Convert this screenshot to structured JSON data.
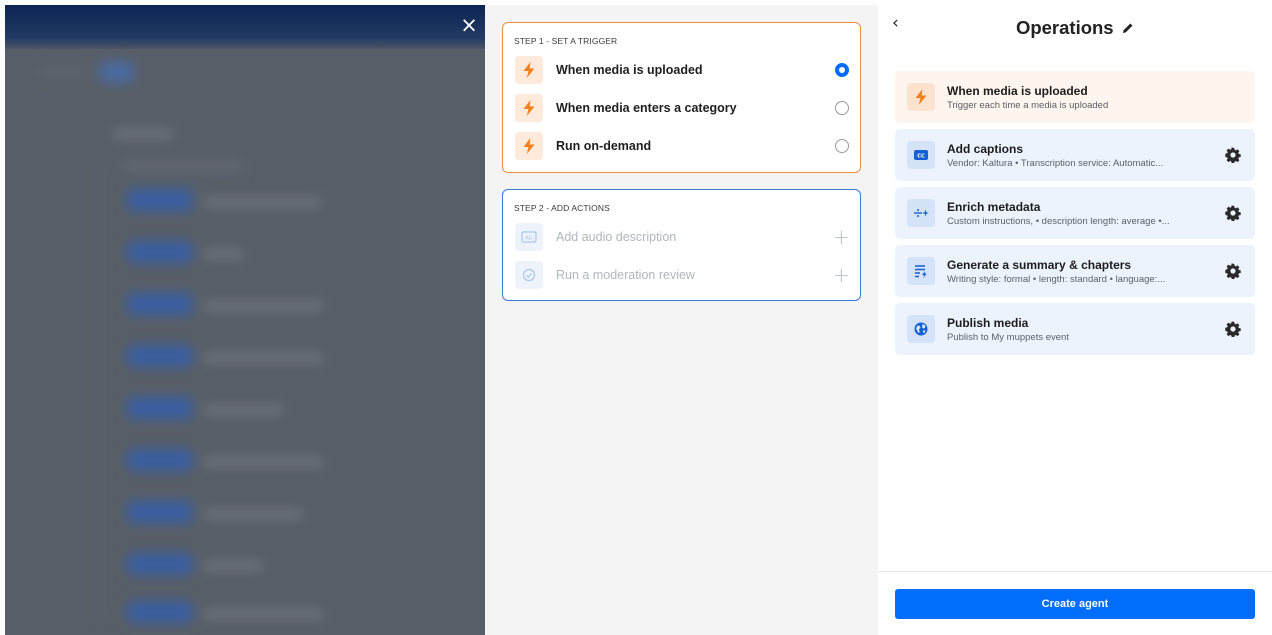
{
  "close_label": "×",
  "step1": {
    "title": "STEP 1 - SET A TRIGGER",
    "options": [
      {
        "label": "When media is uploaded",
        "selected": true,
        "icon": "lightning-icon"
      },
      {
        "label": "When media enters a category",
        "selected": false,
        "icon": "lightning-icon"
      },
      {
        "label": "Run on-demand",
        "selected": false,
        "icon": "lightning-icon"
      }
    ]
  },
  "step2": {
    "title": "STEP 2 - ADD ACTIONS",
    "actions": [
      {
        "label": "Add audio description",
        "icon": "audio-description-icon"
      },
      {
        "label": "Run a moderation review",
        "icon": "check-circle-icon"
      }
    ],
    "add_symbol": "+"
  },
  "operations": {
    "back_symbol": "‹",
    "title": "Operations",
    "trigger": {
      "name": "When media is uploaded",
      "description": "Trigger each time a media is uploaded",
      "icon": "lightning-icon"
    },
    "actions": [
      {
        "name": "Add captions",
        "description": "Vendor: Kaltura • Transcription service: Automatic...",
        "icon": "captions-icon"
      },
      {
        "name": "Enrich metadata",
        "description": "Custom instructions, • description length: average •...",
        "icon": "enrich-icon"
      },
      {
        "name": "Generate a summary & chapters",
        "description": "Writing style: formal • length: standard • language:...",
        "icon": "summary-icon"
      },
      {
        "name": "Publish media",
        "description": "Publish to My muppets event",
        "icon": "globe-icon"
      }
    ],
    "create_button": "Create agent"
  },
  "colors": {
    "accent": "#006efa",
    "trigger_border": "#ec8e3b",
    "actions_border": "#3a79d8",
    "trigger_icon": "#f07f1c"
  }
}
